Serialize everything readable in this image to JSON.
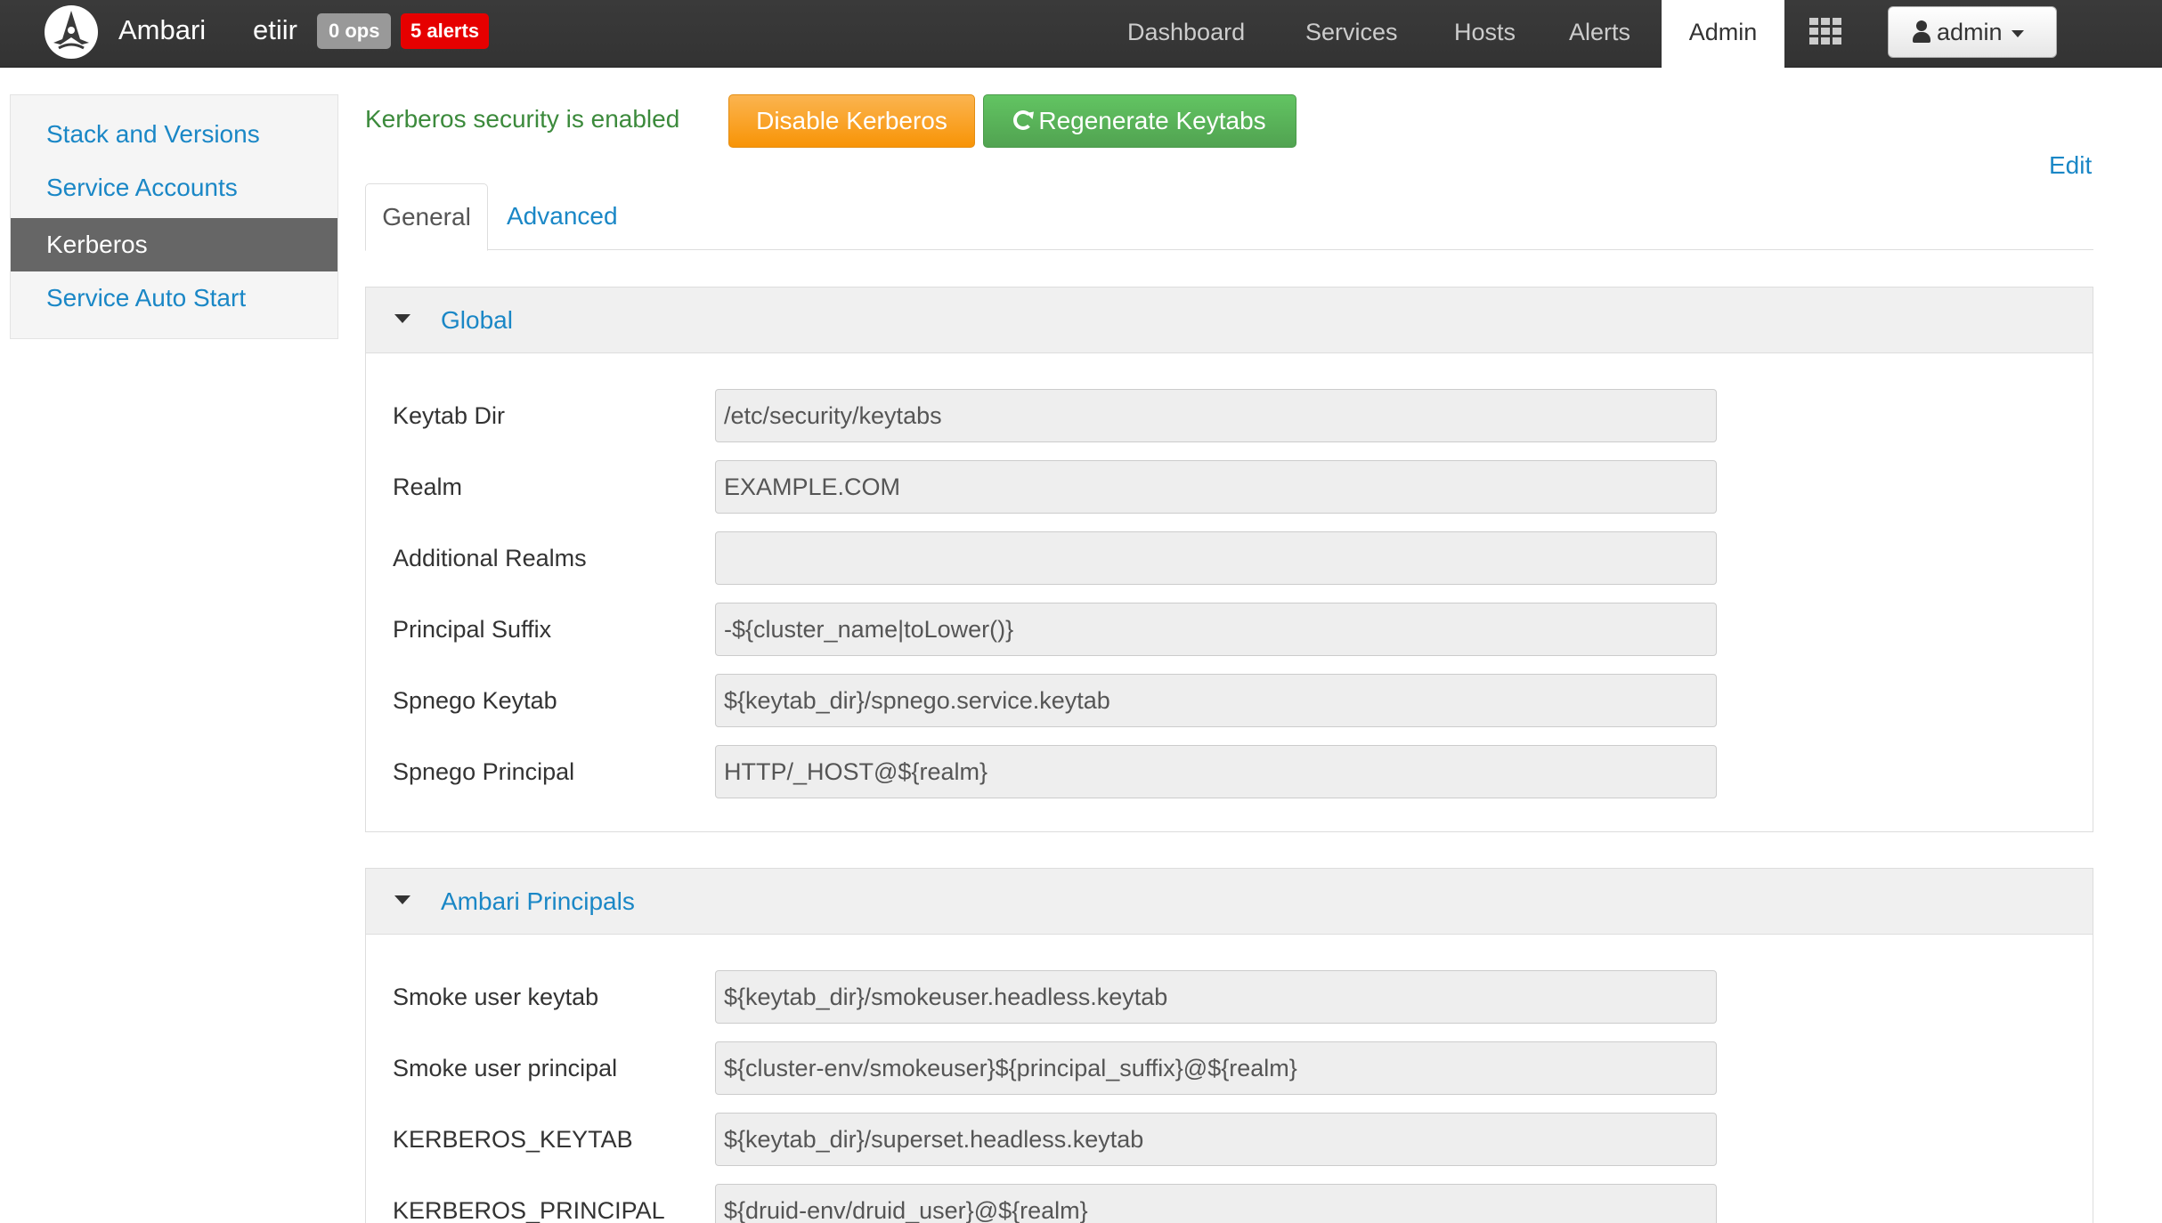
{
  "navbar": {
    "brand": "Ambari",
    "cluster": "etiir",
    "ops_badge": "0 ops",
    "alerts_badge": "5 alerts",
    "links": [
      "Dashboard",
      "Services",
      "Hosts",
      "Alerts"
    ],
    "active_link": "Admin",
    "user_label": "admin"
  },
  "sidebar": {
    "items": [
      {
        "label": "Stack and Versions"
      },
      {
        "label": "Service Accounts"
      },
      {
        "label": "Kerberos"
      },
      {
        "label": "Service Auto Start"
      }
    ],
    "active_index": 2
  },
  "header": {
    "status": "Kerberos security is enabled",
    "disable_button": "Disable Kerberos",
    "regenerate_button": "Regenerate Keytabs",
    "edit_link": "Edit"
  },
  "tabs": {
    "active": "General",
    "other": "Advanced"
  },
  "global_panel": {
    "title": "Global",
    "rows": [
      {
        "label": "Keytab Dir",
        "value": "/etc/security/keytabs"
      },
      {
        "label": "Realm",
        "value": "EXAMPLE.COM"
      },
      {
        "label": "Additional Realms",
        "value": ""
      },
      {
        "label": "Principal Suffix",
        "value": "-${cluster_name|toLower()}"
      },
      {
        "label": "Spnego Keytab",
        "value": "${keytab_dir}/spnego.service.keytab"
      },
      {
        "label": "Spnego Principal",
        "value": "HTTP/_HOST@${realm}"
      }
    ]
  },
  "ambari_panel": {
    "title": "Ambari Principals",
    "rows": [
      {
        "label": "Smoke user keytab",
        "value": "${keytab_dir}/smokeuser.headless.keytab"
      },
      {
        "label": "Smoke user principal",
        "value": "${cluster-env/smokeuser}${principal_suffix}@${realm}"
      },
      {
        "label": "KERBEROS_KEYTAB",
        "value": "${keytab_dir}/superset.headless.keytab"
      },
      {
        "label": "KERBEROS_PRINCIPAL",
        "value": "${druid-env/druid_user}@${realm}"
      }
    ]
  },
  "colors": {
    "navbar": "#333333",
    "link": "#1a87c6",
    "status_green": "#3c8a3c",
    "warning_orange": "#f89406",
    "success_green": "#51a351",
    "alert_red": "#e60000"
  },
  "icons": [
    "ambari-logo-icon",
    "apps-grid-icon",
    "user-icon",
    "caret-down-icon",
    "refresh-icon",
    "collapse-triangle-icon"
  ]
}
